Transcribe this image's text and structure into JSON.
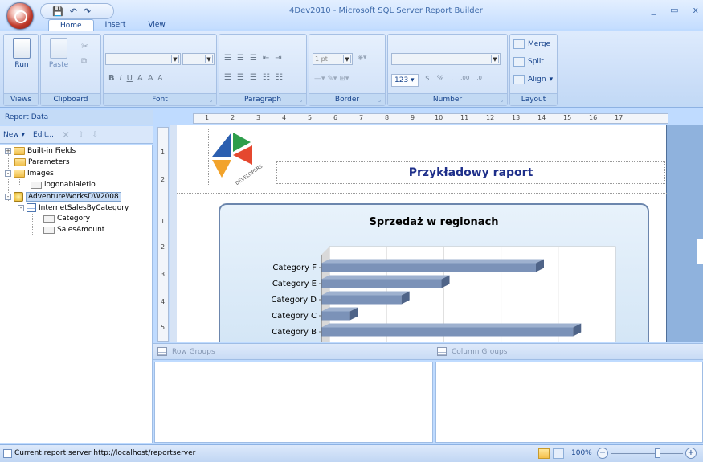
{
  "window": {
    "title": "4Dev2010 - Microsoft SQL Server Report Builder",
    "minimize": "_",
    "maximize": "▭",
    "close": "x"
  },
  "qat": {
    "save": "💾",
    "undo": "↶",
    "redo": "↷"
  },
  "tabs": [
    {
      "label": "Home",
      "active": true
    },
    {
      "label": "Insert",
      "active": false
    },
    {
      "label": "View",
      "active": false
    }
  ],
  "ribbon": {
    "views": {
      "run_label": "Run",
      "group": "Views"
    },
    "clipboard": {
      "paste_label": "Paste",
      "group": "Clipboard"
    },
    "font": {
      "group": "Font",
      "bold": "B",
      "italic": "I",
      "underline": "U",
      "color": "A",
      "grow": "A",
      "shrink": "A"
    },
    "paragraph": {
      "group": "Paragraph"
    },
    "border": {
      "group": "Border",
      "width_value": "1 pt"
    },
    "number": {
      "group": "Number",
      "format": "123",
      "currency": "$",
      "percent": "%",
      "comma": ",",
      "inc_dec": ".00",
      "dec_dec": ".0"
    },
    "layout": {
      "group": "Layout",
      "merge": "Merge",
      "split": "Split",
      "align": "Align"
    }
  },
  "report_data": {
    "header": "Report Data",
    "new_label": "New",
    "edit_label": "Edit...",
    "tree": [
      {
        "label": "Built-in Fields",
        "type": "folder",
        "toggle": "+"
      },
      {
        "label": "Parameters",
        "type": "folder"
      },
      {
        "label": "Images",
        "type": "folder",
        "toggle": "-"
      },
      {
        "label": "logonabialetlo",
        "type": "image"
      },
      {
        "label": "AdventureWorksDW2008",
        "type": "datasource",
        "toggle": "-",
        "selected": true
      },
      {
        "label": "InternetSalesByCategory",
        "type": "dataset",
        "toggle": "-"
      },
      {
        "label": "Category",
        "type": "field"
      },
      {
        "label": "SalesAmount",
        "type": "field"
      }
    ]
  },
  "ruler": {
    "top": [
      "1",
      "2",
      "3",
      "4",
      "5",
      "6",
      "7",
      "8",
      "9",
      "10",
      "11",
      "12",
      "13",
      "14",
      "15",
      "16",
      "17"
    ],
    "left_header": [
      "1",
      "2"
    ],
    "left_body": [
      "1",
      "2",
      "3",
      "4",
      "5"
    ]
  },
  "report": {
    "logo_text": "DEVELOPERS",
    "logo_glyph": "4",
    "title": "Przykładowy raport"
  },
  "chart_data": {
    "type": "bar",
    "title": "Sprzedaż w regionach",
    "orientation": "horizontal",
    "categories": [
      "Category F",
      "Category E",
      "Category D",
      "Category C",
      "Category B"
    ],
    "values": [
      75,
      42,
      28,
      10,
      88
    ],
    "xlim": [
      0,
      100
    ],
    "grid": true,
    "legend": "none"
  },
  "groups": {
    "row_label": "Row Groups",
    "column_label": "Column Groups"
  },
  "status": {
    "text": "Current report server http://localhost/reportserver",
    "zoom": "100%",
    "zoom_minus": "−",
    "zoom_plus": "+"
  },
  "colors": {
    "ribbon_text": "#15428b",
    "bar_face": "#7b92b8",
    "bar_top": "#9eb1cf",
    "bar_side": "#4f6488",
    "report_title": "#1e2f8a"
  }
}
